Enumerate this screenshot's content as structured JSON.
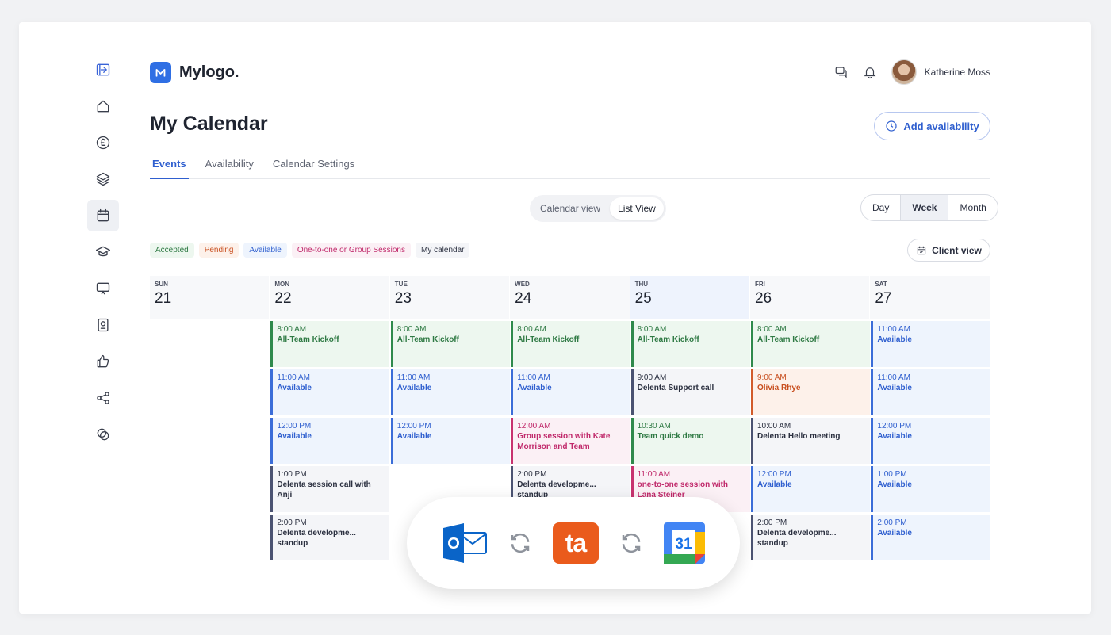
{
  "app": {
    "logo_text": "Mylogo.",
    "user_name": "Katherine Moss"
  },
  "page": {
    "title": "My Calendar",
    "add_button": "Add availability"
  },
  "tabs": [
    "Events",
    "Availability",
    "Calendar Settings"
  ],
  "view_toggle": [
    "Calendar view",
    "List View"
  ],
  "range": [
    "Day",
    "Week",
    "Month"
  ],
  "legend": [
    {
      "label": "Accepted",
      "color": "#2f7a44",
      "bg": "#edf7ef"
    },
    {
      "label": "Pending",
      "color": "#c84e1e",
      "bg": "#fdf1ea"
    },
    {
      "label": "Available",
      "color": "#2f5fcf",
      "bg": "#eef4fd"
    },
    {
      "label": "One-to-one or Group Sessions",
      "color": "#c0286a",
      "bg": "#fbf0f5"
    },
    {
      "label": "My calendar",
      "color": "#2b3040",
      "bg": "#f4f5f8"
    }
  ],
  "client_view": "Client view",
  "days": [
    {
      "dow": "SUN",
      "num": "21",
      "events": []
    },
    {
      "dow": "MON",
      "num": "22",
      "events": [
        {
          "time": "8:00 AM",
          "name": "All-Team Kickoff",
          "kind": "green"
        },
        {
          "time": "11:00 AM",
          "name": "Available",
          "kind": "blue"
        },
        {
          "time": "12:00 PM",
          "name": "Available",
          "kind": "blue"
        },
        {
          "time": "1:00 PM",
          "name": "Delenta session call with Anji",
          "kind": "gray"
        },
        {
          "time": "2:00 PM",
          "name": "Delenta developme... standup",
          "kind": "gray"
        }
      ]
    },
    {
      "dow": "TUE",
      "num": "23",
      "events": [
        {
          "time": "8:00 AM",
          "name": "All-Team Kickoff",
          "kind": "green"
        },
        {
          "time": "11:00 AM",
          "name": "Available",
          "kind": "blue"
        },
        {
          "time": "12:00 PM",
          "name": "Available",
          "kind": "blue"
        }
      ]
    },
    {
      "dow": "WED",
      "num": "24",
      "events": [
        {
          "time": "8:00 AM",
          "name": "All-Team Kickoff",
          "kind": "green"
        },
        {
          "time": "11:00 AM",
          "name": "Available",
          "kind": "blue"
        },
        {
          "time": "12:00 AM",
          "name": "Group session with Kate Morrison and Team",
          "kind": "pink"
        },
        {
          "time": "2:00 PM",
          "name": "Delenta developme... standup",
          "kind": "gray"
        }
      ]
    },
    {
      "dow": "THU",
      "num": "25",
      "today": true,
      "events": [
        {
          "time": "8:00 AM",
          "name": "All-Team Kickoff",
          "kind": "green"
        },
        {
          "time": "9:00 AM",
          "name": "Delenta Support call",
          "kind": "gray"
        },
        {
          "time": "10:30 AM",
          "name": "Team quick demo",
          "kind": "green"
        },
        {
          "time": "11:00 AM",
          "name": "one-to-one session with Lana Steiner",
          "kind": "pink"
        }
      ]
    },
    {
      "dow": "FRI",
      "num": "26",
      "events": [
        {
          "time": "8:00 AM",
          "name": "All-Team Kickoff",
          "kind": "green"
        },
        {
          "time": "9:00 AM",
          "name": "Olivia Rhye",
          "kind": "orange"
        },
        {
          "time": "10:00 AM",
          "name": "Delenta Hello meeting",
          "kind": "gray"
        },
        {
          "time": "12:00 PM",
          "name": "Available",
          "kind": "blue"
        },
        {
          "time": "2:00 PM",
          "name": "Delenta developme... standup",
          "kind": "gray"
        }
      ]
    },
    {
      "dow": "SAT",
      "num": "27",
      "events": [
        {
          "time": "11:00 AM",
          "name": "Available",
          "kind": "blue"
        },
        {
          "time": "11:00 AM",
          "name": "Available",
          "kind": "blue"
        },
        {
          "time": "12:00 PM",
          "name": "Available",
          "kind": "blue"
        },
        {
          "time": "1:00 PM",
          "name": "Available",
          "kind": "blue"
        },
        {
          "time": "2:00 PM",
          "name": "Available",
          "kind": "blue"
        }
      ]
    }
  ],
  "sync": {
    "outlook_letter": "O",
    "ta_text": "ta",
    "gcal_number": "31"
  }
}
